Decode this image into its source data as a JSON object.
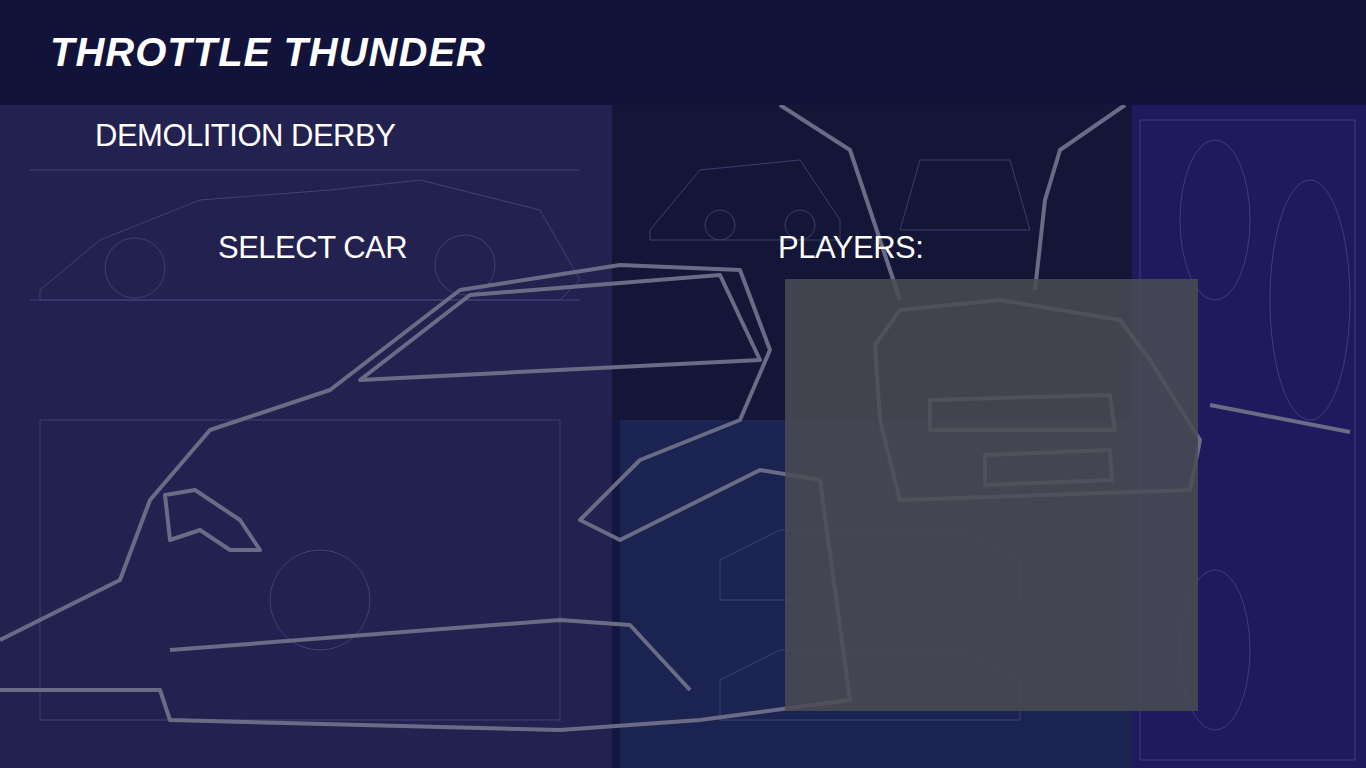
{
  "header": {
    "title": "THROTTLE THUNDER"
  },
  "mode": {
    "label": "DEMOLITION DERBY"
  },
  "select_car": {
    "label": "SELECT CAR"
  },
  "players": {
    "label": "PLAYERS:"
  }
}
